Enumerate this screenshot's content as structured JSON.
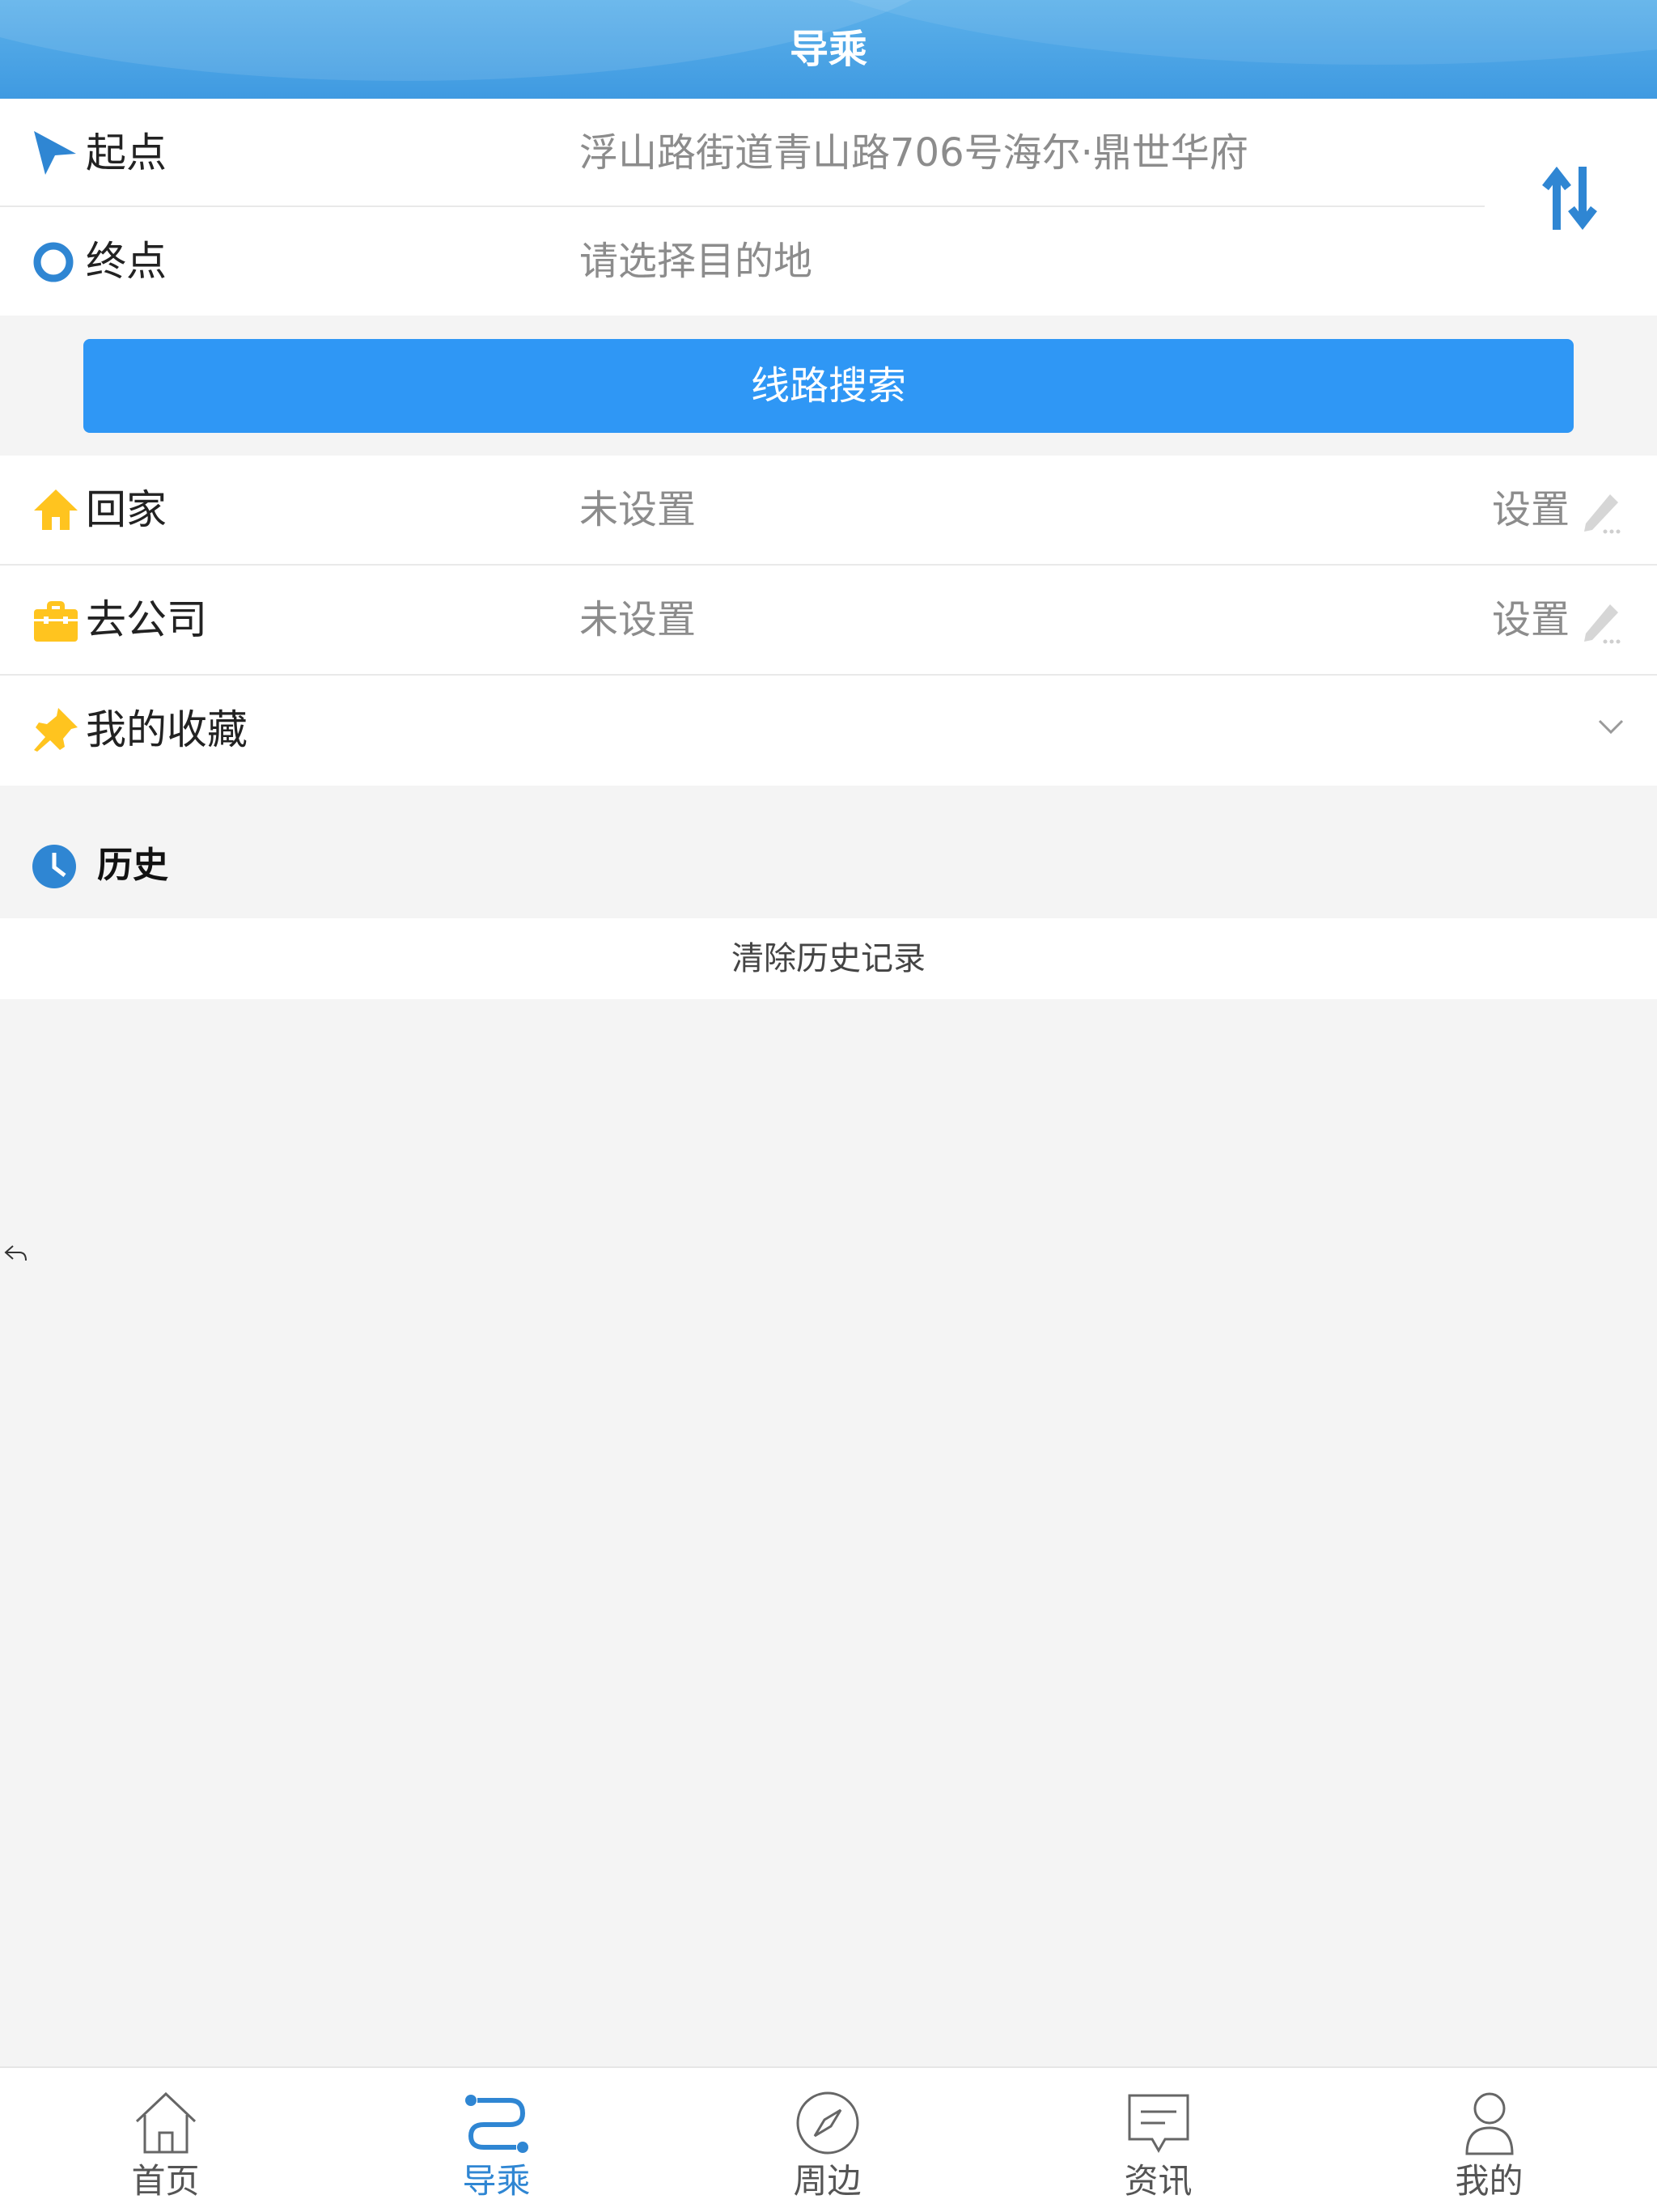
{
  "header": {
    "title": "导乘"
  },
  "route": {
    "start": {
      "label": "起点",
      "value": "浮山路街道青山路706号海尔·鼎世华府"
    },
    "end": {
      "label": "终点",
      "placeholder": "请选择目的地"
    },
    "swap_icon": "swap-vertical-icon"
  },
  "search": {
    "label": "线路搜索"
  },
  "shortcuts": [
    {
      "label": "回家",
      "value": "未设置",
      "action": "设置",
      "icon": "home-icon"
    },
    {
      "label": "去公司",
      "value": "未设置",
      "action": "设置",
      "icon": "briefcase-icon"
    }
  ],
  "favorites": {
    "label": "我的收藏",
    "icon": "pin-icon"
  },
  "history": {
    "label": "历史",
    "clear_label": "清除历史记录",
    "icon": "clock-icon"
  },
  "tabbar": {
    "items": [
      {
        "label": "首页",
        "icon": "home-outline-icon",
        "active": false
      },
      {
        "label": "导乘",
        "icon": "route-icon",
        "active": true
      },
      {
        "label": "周边",
        "icon": "compass-icon",
        "active": false
      },
      {
        "label": "资讯",
        "icon": "message-icon",
        "active": false
      },
      {
        "label": "我的",
        "icon": "user-icon",
        "active": false
      }
    ]
  },
  "colors": {
    "accent": "#2f97f5",
    "header": "#4aa5e6",
    "active_tab": "#2f86d3",
    "icon_yellow": "#ffc41f"
  }
}
